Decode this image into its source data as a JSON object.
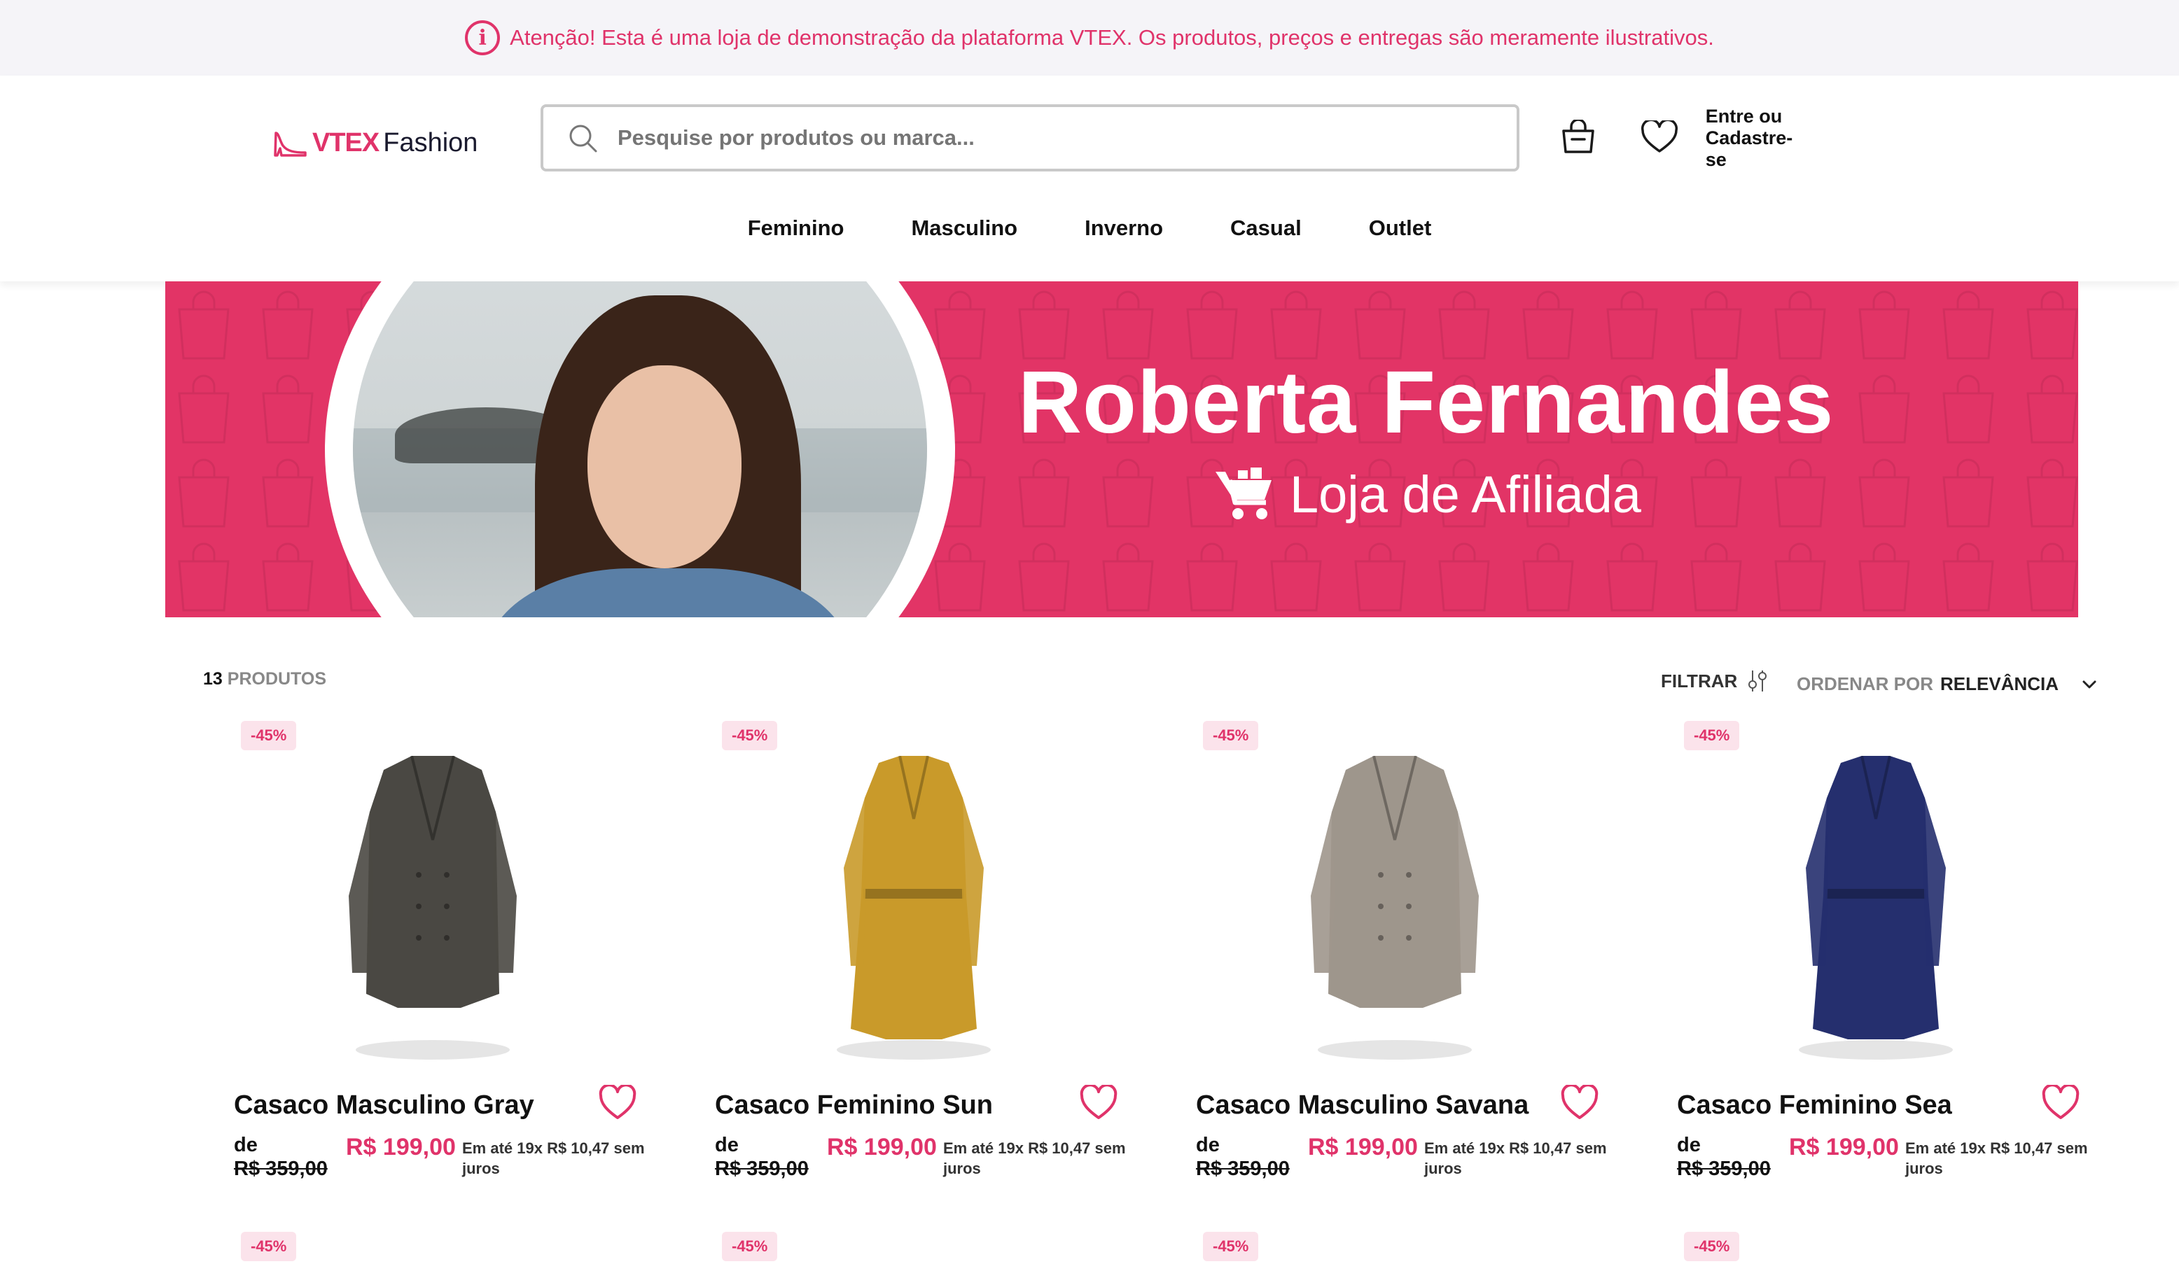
{
  "alert": {
    "icon": "info-icon",
    "text": "Atenção! Esta é uma loja de demonstração da plataforma VTEX. Os produtos, preços e entregas são meramente ilustrativos."
  },
  "header": {
    "logo_vtex": "VTEX",
    "logo_fashion": "Fashion",
    "search_placeholder": "Pesquise por produtos ou marca...",
    "login_label": "Entre ou Cadastre-se"
  },
  "nav": [
    "Feminino",
    "Masculino",
    "Inverno",
    "Casual",
    "Outlet"
  ],
  "banner": {
    "name": "Roberta Fernandes",
    "subtitle": "Loja de Afiliada"
  },
  "toolbar": {
    "count_number": "13",
    "count_label": "PRODUTOS",
    "filter_label": "FILTRAR",
    "order_label": "ORDENAR POR",
    "order_value": "RELEVÂNCIA"
  },
  "products": [
    {
      "badge": "-45%",
      "name": "Casaco Masculino Gray",
      "de": "de",
      "old_price": "R$ 359,00",
      "price": "R$ 199,00",
      "installments": "Em até 19x R$ 10,47 sem juros",
      "color": "#4a4843"
    },
    {
      "badge": "-45%",
      "name": "Casaco Feminino Sun",
      "de": "de",
      "old_price": "R$ 359,00",
      "price": "R$ 199,00",
      "installments": "Em até 19x R$ 10,47 sem juros",
      "color": "#c99a2a"
    },
    {
      "badge": "-45%",
      "name": "Casaco Masculino Savana",
      "de": "de",
      "old_price": "R$ 359,00",
      "price": "R$ 199,00",
      "installments": "Em até 19x R$ 10,47 sem juros",
      "color": "#9e968c"
    },
    {
      "badge": "-45%",
      "name": "Casaco Feminino Sea",
      "de": "de",
      "old_price": "R$ 359,00",
      "price": "R$ 199,00",
      "installments": "Em até 19x R$ 10,47 sem juros",
      "color": "#252f6e"
    }
  ],
  "second_row_badges": [
    "-45%",
    "-45%",
    "-45%",
    "-45%"
  ],
  "colors": {
    "brand": "#e0336a",
    "banner": "#e23466"
  }
}
